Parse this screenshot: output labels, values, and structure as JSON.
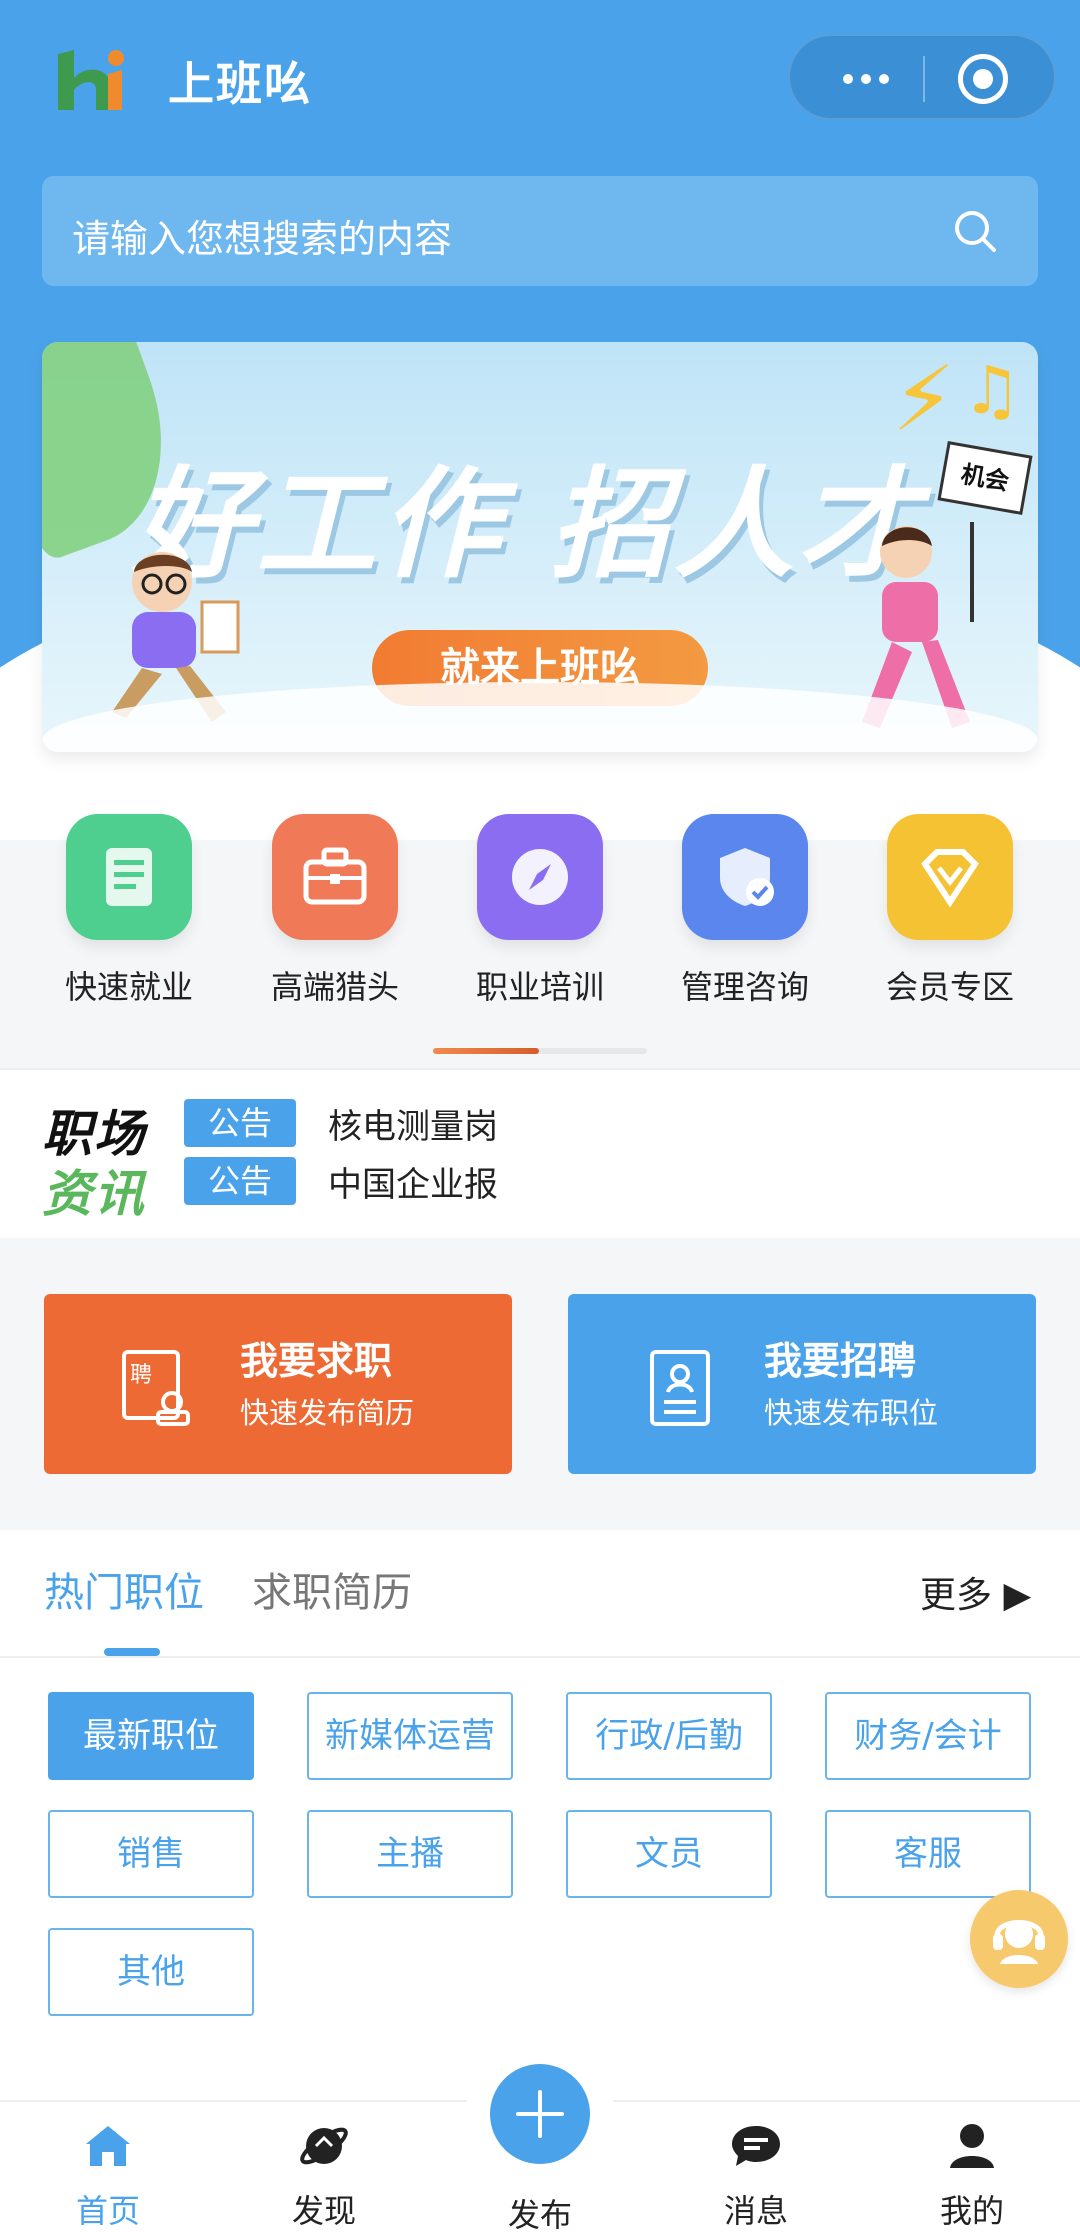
{
  "app": {
    "title": "上班吆"
  },
  "search": {
    "placeholder": "请输入您想搜索的内容"
  },
  "banner": {
    "headline": "好工作 招人才",
    "pill": "就来上班吆",
    "sign": "机会"
  },
  "quick_links": [
    {
      "label": "快速就业",
      "icon": "document-icon",
      "color": "#4fcf8f"
    },
    {
      "label": "高端猎头",
      "icon": "briefcase-icon",
      "color": "#f07a58"
    },
    {
      "label": "职业培训",
      "icon": "compass-icon",
      "color": "#8a6df0"
    },
    {
      "label": "管理咨询",
      "icon": "shield-check-icon",
      "color": "#5a86ee"
    },
    {
      "label": "会员专区",
      "icon": "diamond-icon",
      "color": "#f5c233"
    }
  ],
  "news": {
    "logo_line1": "职场",
    "logo_line2": "资讯",
    "items": [
      {
        "tag": "公告",
        "text": "核电测量岗"
      },
      {
        "tag": "公告",
        "text": "中国企业报"
      }
    ]
  },
  "cta": {
    "seek": {
      "title": "我要求职",
      "subtitle": "快速发布简历",
      "color": "#ee6a35"
    },
    "hire": {
      "title": "我要招聘",
      "subtitle": "快速发布职位",
      "color": "#4aa3ea"
    }
  },
  "jobs": {
    "tabs": [
      "热门职位",
      "求职简历"
    ],
    "more": "更多 ▶",
    "categories": [
      "最新职位",
      "新媒体运营",
      "行政/后勤",
      "财务/会计",
      "销售",
      "主播",
      "文员",
      "客服",
      "其他"
    ]
  },
  "tabbar": {
    "items": [
      "首页",
      "发现",
      "发布",
      "消息",
      "我的"
    ],
    "active_color": "#4aa3ea"
  }
}
